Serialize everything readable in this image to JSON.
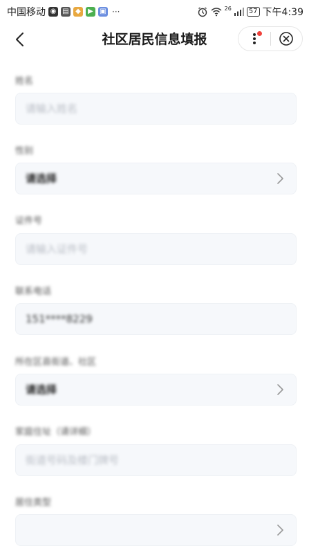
{
  "status_bar": {
    "carrier": "中国移动",
    "ellipsis": "···",
    "network": "26",
    "battery": "57",
    "time": "下午4:39"
  },
  "nav": {
    "title": "社区居民信息填报"
  },
  "form": {
    "fields": [
      {
        "label": "姓名",
        "value": "请输入姓名",
        "kind": "input",
        "has_value": false
      },
      {
        "label": "性别",
        "value": "请选择",
        "kind": "select",
        "has_value": false
      },
      {
        "label": "证件号",
        "value": "请输入证件号",
        "kind": "input",
        "has_value": false
      },
      {
        "label": "联系电话",
        "value": "151****8229",
        "kind": "input",
        "has_value": true
      },
      {
        "label": "所在区县街道、社区",
        "value": "请选择",
        "kind": "select",
        "has_value": false
      },
      {
        "label": "家庭住址（请详细）",
        "value": "街道号码及楼门牌号",
        "kind": "input",
        "has_value": false
      },
      {
        "label": "居住类型",
        "value": "",
        "kind": "select",
        "has_value": false
      }
    ]
  },
  "colors": {
    "field_bg": "#f6f8fb",
    "badge_red": "#f0413b"
  }
}
